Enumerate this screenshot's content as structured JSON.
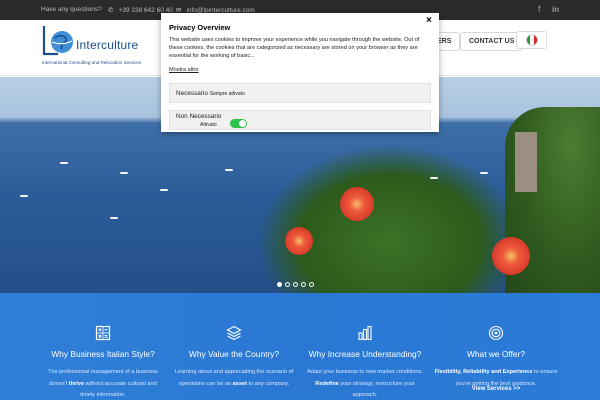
{
  "topbar": {
    "question": "Have any questions?",
    "phone": "+39 338 642 60 40",
    "email": "info@lpinterculture.com",
    "social": [
      "facebook-icon",
      "linkedin-icon"
    ]
  },
  "header": {
    "logo_text": "Interculture",
    "logo_tagline": "International Consulting and Relocation Services",
    "nav": [
      {
        "label": "ERS"
      },
      {
        "label": "CONTACT US"
      }
    ],
    "language": "Italian"
  },
  "hero": {
    "slides_total": 5,
    "active_slide": 0
  },
  "features": [
    {
      "icon": "calculator-icon",
      "title": "Why Business Italian Style?",
      "desc_before": "The professional management of a business doesn't ",
      "desc_bold": "thrive",
      "desc_after": " without accurate cultural and timely information."
    },
    {
      "icon": "layers-icon",
      "title": "Why Value the Country?",
      "desc_before": "Learning about and appreciating the scenario of operations can be an ",
      "desc_bold": "asset",
      "desc_after": " to any company."
    },
    {
      "icon": "bar-chart-icon",
      "title": "Why Increase Understanding?",
      "desc_before": "Adapt your business to new market conditions. ",
      "desc_bold": "Redefine",
      "desc_after": " your strategy, restructure your approach."
    },
    {
      "icon": "target-icon",
      "title": "What we Offer?",
      "desc_before": "",
      "desc_bold": "Flexibility, Reliability and Experience",
      "desc_after": " to ensure you're getting the best guidance.",
      "link": "View Services >>"
    }
  ],
  "modal": {
    "title": "Privacy Overview",
    "close": "×",
    "text": "This website uses cookies to improve your experience while you navigate through the website. Out of these cookies, the cookies that are categorized as necessary are stored on your browser as they are essential for the working of basic...",
    "more": "Mostra altro",
    "rows": [
      {
        "label": "Necessario",
        "status": "Sempre attivato"
      },
      {
        "label": "Non Necessario",
        "status": "Attivato"
      }
    ]
  },
  "colors": {
    "topbar": "#2b2b2b",
    "features_bg": "#2f7fd8",
    "toggle_on": "#2ec14b",
    "brand": "#1d4f8c"
  }
}
